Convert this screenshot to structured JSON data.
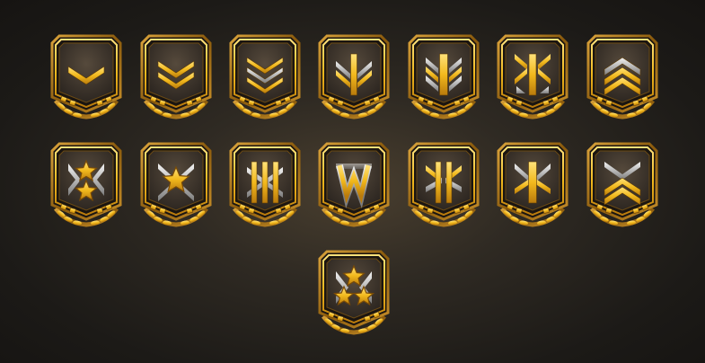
{
  "screen": {
    "title": "",
    "theme": {
      "background": "#1c1a17",
      "gold": "#f2b91d",
      "gold_dark": "#8a5a0c",
      "silver": "#cfcfcf",
      "field": "#3a322b"
    }
  },
  "badges": [
    {
      "id": 1,
      "rank_icon": "chevron-1"
    },
    {
      "id": 2,
      "rank_icon": "chevron-2"
    },
    {
      "id": 3,
      "rank_icon": "chevron-3"
    },
    {
      "id": 4,
      "rank_icon": "chevron-3-bar"
    },
    {
      "id": 5,
      "rank_icon": "chevron-3-bar-wide"
    },
    {
      "id": 6,
      "rank_icon": "chevron-4-bar"
    },
    {
      "id": 7,
      "rank_icon": "inverted-chevron-3"
    },
    {
      "id": 8,
      "rank_icon": "star-2"
    },
    {
      "id": 9,
      "rank_icon": "star-1-crossed"
    },
    {
      "id": 10,
      "rank_icon": "bars-3-crossed"
    },
    {
      "id": 11,
      "rank_icon": "double-w"
    },
    {
      "id": 12,
      "rank_icon": "bars-2-crossed"
    },
    {
      "id": 13,
      "rank_icon": "bar-1-crossed"
    },
    {
      "id": 14,
      "rank_icon": "double-chevron-crossed"
    },
    {
      "id": 15,
      "rank_icon": "star-3"
    }
  ]
}
